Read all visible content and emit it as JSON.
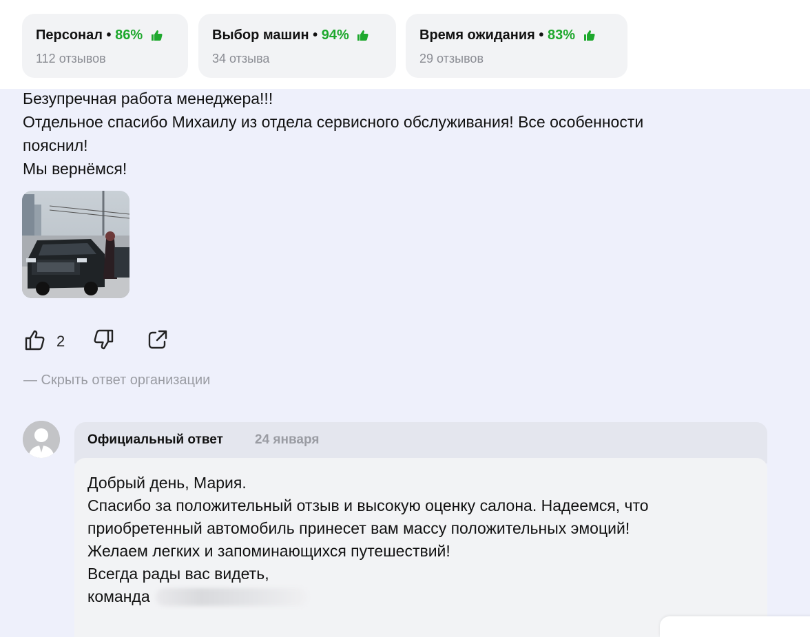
{
  "ratings": [
    {
      "label": "Персонал",
      "percent": "86%",
      "count": "112 отзывов"
    },
    {
      "label": "Выбор машин",
      "percent": "94%",
      "count": "34 отзыва"
    },
    {
      "label": "Время ожидания",
      "percent": "83%",
      "count": "29 отзывов"
    }
  ],
  "review": {
    "lines": [
      "Безупречная работа менеджера!!!",
      "Отдельное спасибо Михаилу из отдела сервисного обслуживания! Все особенности",
      "пояснил!",
      "Мы вернёмся!"
    ],
    "likes": "2",
    "hide_reply": "— Скрыть ответ организации"
  },
  "reply": {
    "label": "Официальный ответ",
    "date": "24 января",
    "lines": [
      "Добрый день, Мария.",
      "Спасибо за положительный отзыв и высокую оценку салона. Надеемся, что",
      "приобретенный автомобиль принесет вам массу положительных эмоций!",
      "Желаем легких и запоминающихся путешествий!",
      "Всегда рады вас видеть,",
      "команда"
    ]
  },
  "colors": {
    "accent_green": "#1ea82d",
    "muted": "#9a9ca3"
  },
  "icons": [
    "thumbs-up-icon",
    "like-icon",
    "dislike-icon",
    "share-icon",
    "avatar-placeholder-icon"
  ]
}
